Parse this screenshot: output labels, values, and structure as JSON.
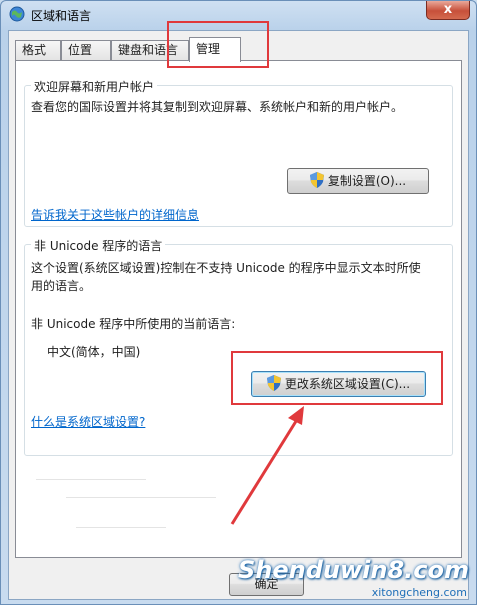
{
  "window": {
    "title": "区域和语言",
    "close_label": "x"
  },
  "tabs": [
    {
      "label": "格式"
    },
    {
      "label": "位置"
    },
    {
      "label": "键盘和语言"
    },
    {
      "label": "管理"
    }
  ],
  "welcome_group": {
    "title": "欢迎屏幕和新用户帐户",
    "description": "查看您的国际设置并将其复制到欢迎屏幕、系统帐户和新的用户帐户。",
    "copy_button": "复制设置(O)...",
    "link": "告诉我关于这些帐户的详细信息"
  },
  "unicode_group": {
    "title": "非 Unicode 程序的语言",
    "description_line1": "这个设置(系统区域设置)控制在不支持 Unicode 的程序中显示文本时所使",
    "description_line2": "用的语言。",
    "current_label": "非 Unicode 程序中所使用的当前语言:",
    "current_value": "中文(简体，中国)",
    "change_button": "更改系统区域设置(C)...",
    "link": "什么是系统区域设置?"
  },
  "footer": {
    "ok_button": "确定"
  },
  "watermark": {
    "main": "Shenduwin8.com",
    "sub": "xitongcheng.com"
  },
  "colors": {
    "annotation_red": "#e0393c",
    "link_blue": "#0066cc",
    "shield_blue": "#2f6fc4",
    "shield_yellow": "#f3c531"
  }
}
